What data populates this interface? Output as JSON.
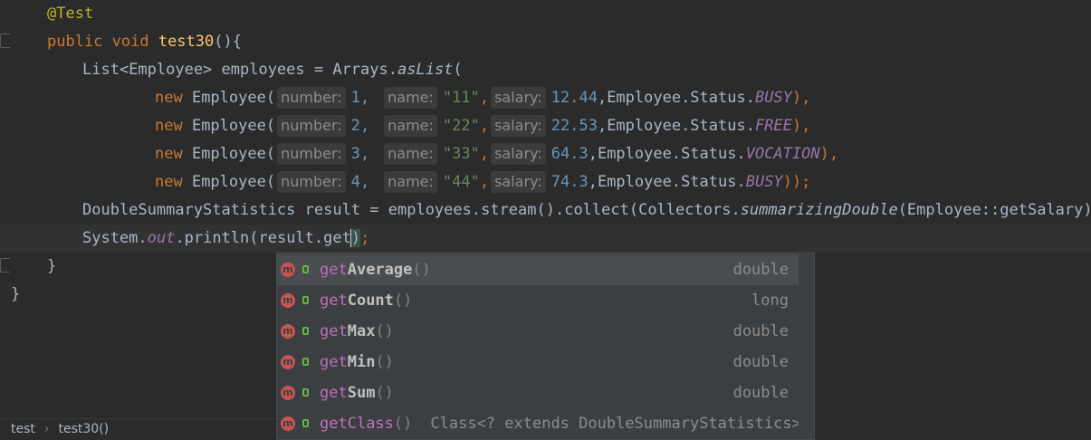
{
  "editor": {
    "annotation": "@Test",
    "method_kw": "public void ",
    "method_name": "test30",
    "method_tail": "(){",
    "list_decl": "List<Employee> employees = Arrays.",
    "as_list": "asList",
    "open_paren": "(",
    "employees": [
      {
        "kw": "new",
        "cls": " Employee(",
        "h1": "number:",
        "n": "1,",
        "h2": "name:",
        "name": "\"11\"",
        "h3": "salary:",
        "salary": "12.44",
        "status_pre": ",Employee.Status.",
        "status": "BUSY",
        "end": "),"
      },
      {
        "kw": "new",
        "cls": " Employee(",
        "h1": "number:",
        "n": "2,",
        "h2": "name:",
        "name": "\"22\"",
        "h3": "salary:",
        "salary": "22.53",
        "status_pre": ",Employee.Status.",
        "status": "FREE",
        "end": "),"
      },
      {
        "kw": "new",
        "cls": " Employee(",
        "h1": "number:",
        "n": "3,",
        "h2": "name:",
        "name": "\"33\"",
        "h3": "salary:",
        "salary": "64.3",
        "status_pre": ",Employee.Status.",
        "status": "VOCATION",
        "end": "),"
      },
      {
        "kw": "new",
        "cls": " Employee(",
        "h1": "number:",
        "n": "4,",
        "h2": "name:",
        "name": "\"44\"",
        "h3": "salary:",
        "salary": "74.3",
        "status_pre": ",Employee.Status.",
        "status": "BUSY",
        "end": "));"
      }
    ],
    "stats_pre": "DoubleSummaryStatistics result = employees.stream().collect(Collectors.",
    "stats_method": "summarizingDouble",
    "stats_post": "(Employee::getSalary));",
    "print_pre": "System.",
    "print_out": "out",
    "print_mid": ".println(result.get",
    "print_close": ")",
    "print_end": ";",
    "close_method": "}",
    "close_class": "}"
  },
  "completion": {
    "items": [
      {
        "prefix": "get",
        "rest": "Average",
        "params": "()",
        "type": "double",
        "selected": true
      },
      {
        "prefix": "get",
        "rest": "Count",
        "params": "()",
        "type": "long"
      },
      {
        "prefix": "get",
        "rest": "Max",
        "params": "()",
        "type": "double"
      },
      {
        "prefix": "get",
        "rest": "Min",
        "params": "()",
        "type": "double"
      },
      {
        "prefix": "get",
        "rest": "Sum",
        "params": "()",
        "type": "double"
      },
      {
        "prefix": "get",
        "rest": "Class",
        "params": "()",
        "sig": "Class<? extends DoubleSummaryStatistics>"
      }
    ],
    "icon_letter": "m"
  },
  "breadcrumb": {
    "items": [
      "test",
      "test30()"
    ]
  }
}
